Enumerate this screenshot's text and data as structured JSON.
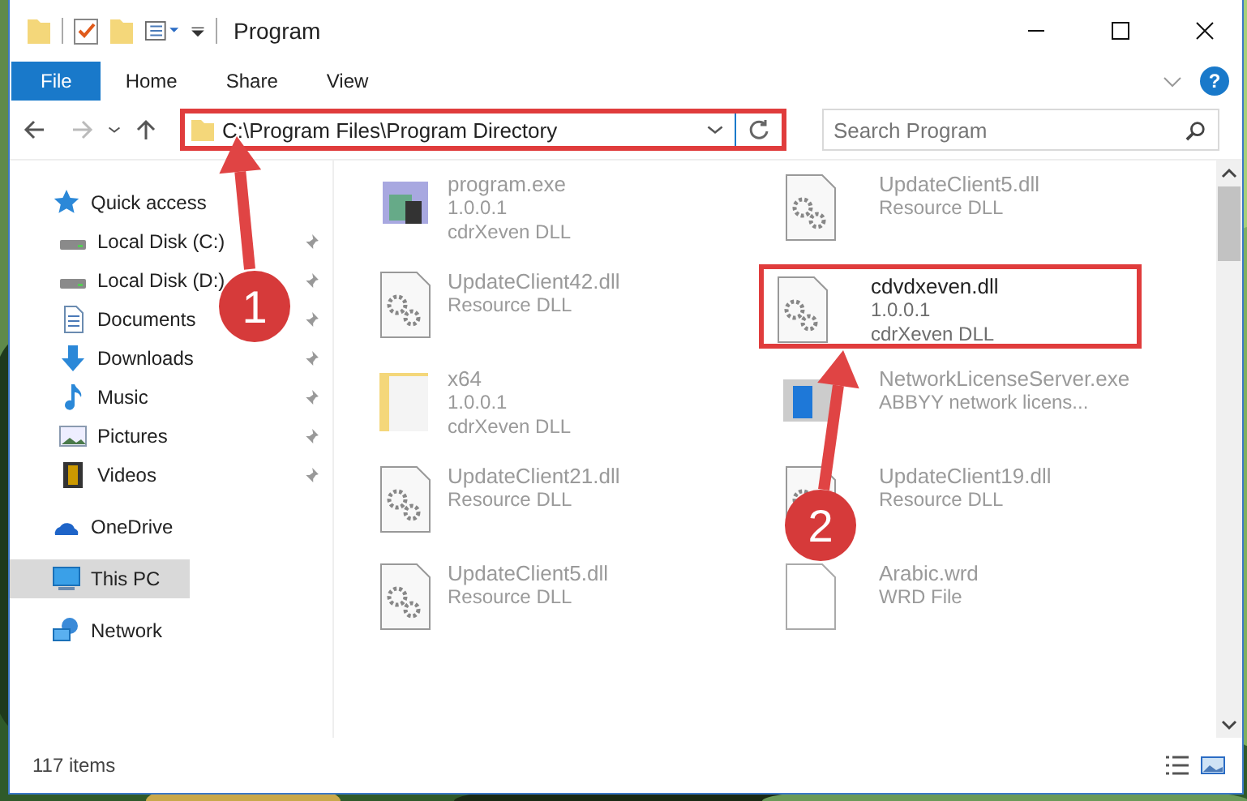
{
  "window": {
    "title": "Program"
  },
  "ribbon": {
    "help": "?",
    "tabs": [
      {
        "label": "File",
        "selected": true
      },
      {
        "label": "Home",
        "selected": false
      },
      {
        "label": "Share",
        "selected": false
      },
      {
        "label": "View",
        "selected": false
      }
    ]
  },
  "address_bar": {
    "path": "C:\\Program Files\\Program Directory",
    "annotated": true
  },
  "search": {
    "placeholder": "Search Program"
  },
  "navigation": [
    {
      "label": "Quick access",
      "kind": "star",
      "selected": false,
      "children": [
        {
          "label": "Local Disk (C:)",
          "kind": "disk",
          "pinned": true,
          "selected": false
        },
        {
          "label": "Local Disk (D:)",
          "kind": "disk",
          "pinned": true,
          "selected": false
        },
        {
          "label": "Documents",
          "kind": "document",
          "pinned": true,
          "selected": false
        },
        {
          "label": "Downloads",
          "kind": "download",
          "pinned": true,
          "selected": false
        },
        {
          "label": "Music",
          "kind": "music",
          "pinned": true,
          "selected": false
        },
        {
          "label": "Pictures",
          "kind": "pictures",
          "pinned": true,
          "selected": false
        },
        {
          "label": "Videos",
          "kind": "video",
          "pinned": true,
          "selected": false
        }
      ]
    },
    {
      "label": "OneDrive",
      "kind": "cloud",
      "selected": false
    },
    {
      "label": "This PC",
      "kind": "computer",
      "selected": true
    },
    {
      "label": "Network",
      "kind": "network",
      "selected": false
    }
  ],
  "files": [
    {
      "name": "program.exe",
      "details": [
        "1.0.0.1",
        "cdrXeven DLL"
      ],
      "kind": "exe",
      "blurred": true,
      "annotated": false
    },
    {
      "name": "UpdateClient5.dll",
      "details": [
        "Resource DLL"
      ],
      "kind": "dll",
      "blurred": true,
      "annotated": false
    },
    {
      "name": "UpdateClient42.dll",
      "details": [
        "Resource DLL"
      ],
      "kind": "dll",
      "blurred": true,
      "annotated": false
    },
    {
      "name": "cdvdxeven.dll",
      "details": [
        "1.0.0.1",
        "cdrXeven DLL"
      ],
      "kind": "dll",
      "blurred": false,
      "annotated": true
    },
    {
      "name": "x64",
      "details": [
        "1.0.0.1",
        "cdrXeven DLL"
      ],
      "kind": "folder",
      "blurred": true,
      "annotated": false
    },
    {
      "name": "NetworkLicenseServer.exe",
      "details": [
        "ABBYY network licens..."
      ],
      "kind": "app",
      "blurred": true,
      "annotated": false
    },
    {
      "name": "UpdateClient21.dll",
      "details": [
        "Resource DLL"
      ],
      "kind": "dll",
      "blurred": true,
      "annotated": false
    },
    {
      "name": "UpdateClient19.dll",
      "details": [
        "Resource DLL"
      ],
      "kind": "dll",
      "blurred": true,
      "annotated": false
    },
    {
      "name": "UpdateClient5.dll",
      "details": [
        "Resource DLL"
      ],
      "kind": "dll",
      "blurred": true,
      "annotated": false
    },
    {
      "name": "Arabic.wrd",
      "details": [
        "WRD File"
      ],
      "kind": "file",
      "blurred": true,
      "annotated": false
    }
  ],
  "status_bar": {
    "item_count": "117 items"
  },
  "annotations": [
    {
      "label": "1"
    },
    {
      "label": "2"
    }
  ]
}
